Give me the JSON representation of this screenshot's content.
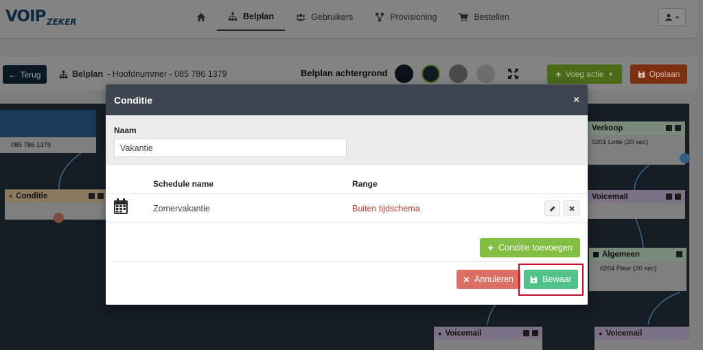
{
  "logo": {
    "primary": "VOIP",
    "secondary": "ZEKER"
  },
  "nav": {
    "items": [
      {
        "label": "",
        "icon": "home-icon"
      },
      {
        "label": "Belplan",
        "icon": "sitemap-icon",
        "active": true
      },
      {
        "label": "Gebruikers",
        "icon": "users-icon"
      },
      {
        "label": "Provisioning",
        "icon": "network-icon"
      },
      {
        "label": "Bestellen",
        "icon": "cart-icon"
      }
    ]
  },
  "toolbar": {
    "back_label": "Terug",
    "breadcrumb_title": "Belplan",
    "breadcrumb_rest": "- Hoofdnummer - 085 786 1379",
    "background_label": "Belplan achtergrond",
    "swatches": [
      "#0a1017",
      "#0f1a22",
      "#4a4a4a",
      "#6e6e6e"
    ],
    "add_action_label": "Voeg actie",
    "save_label": "Opslaan"
  },
  "canvas": {
    "number_node": {
      "body": "085 786 1379",
      "color": "#1b3a5a"
    },
    "condition_node": {
      "title": "Conditie",
      "color": "#8a7a60"
    },
    "verkoop_node": {
      "title": "Verkoop",
      "body": "0201 Lotte (20 sec)",
      "color": "#7a8a7a"
    },
    "voicemail_right": {
      "title": "Voicemail",
      "color": "#7c7287"
    },
    "algemeen_node": {
      "title": "Algemeen",
      "body": "0204 Fleur (20 sec)",
      "color": "#7a8a7a"
    },
    "voicemail_bottom_left": {
      "title": "Voicemail",
      "color": "#7c7287"
    },
    "voicemail_bottom_right": {
      "title": "Voicemail",
      "color": "#7c7287"
    }
  },
  "modal": {
    "title": "Conditie",
    "close": "×",
    "name_label": "Naam",
    "name_value": "Vakantie",
    "col_schedule": "Schedule name",
    "col_range": "Range",
    "rows": [
      {
        "schedule_name": "Zomervakantie",
        "range": "Buiten tijdschema"
      }
    ],
    "add_condition_label": "Conditie toevoegen",
    "cancel_label": "Annuleren",
    "save_label": "Bewaar"
  },
  "colors": {
    "modal_header": "#3e4551",
    "add_green": "#82be41",
    "cancel_red": "#dd7065",
    "save_green": "#52c28b",
    "range_red": "#c0392b",
    "highlight": "#c8102e"
  }
}
